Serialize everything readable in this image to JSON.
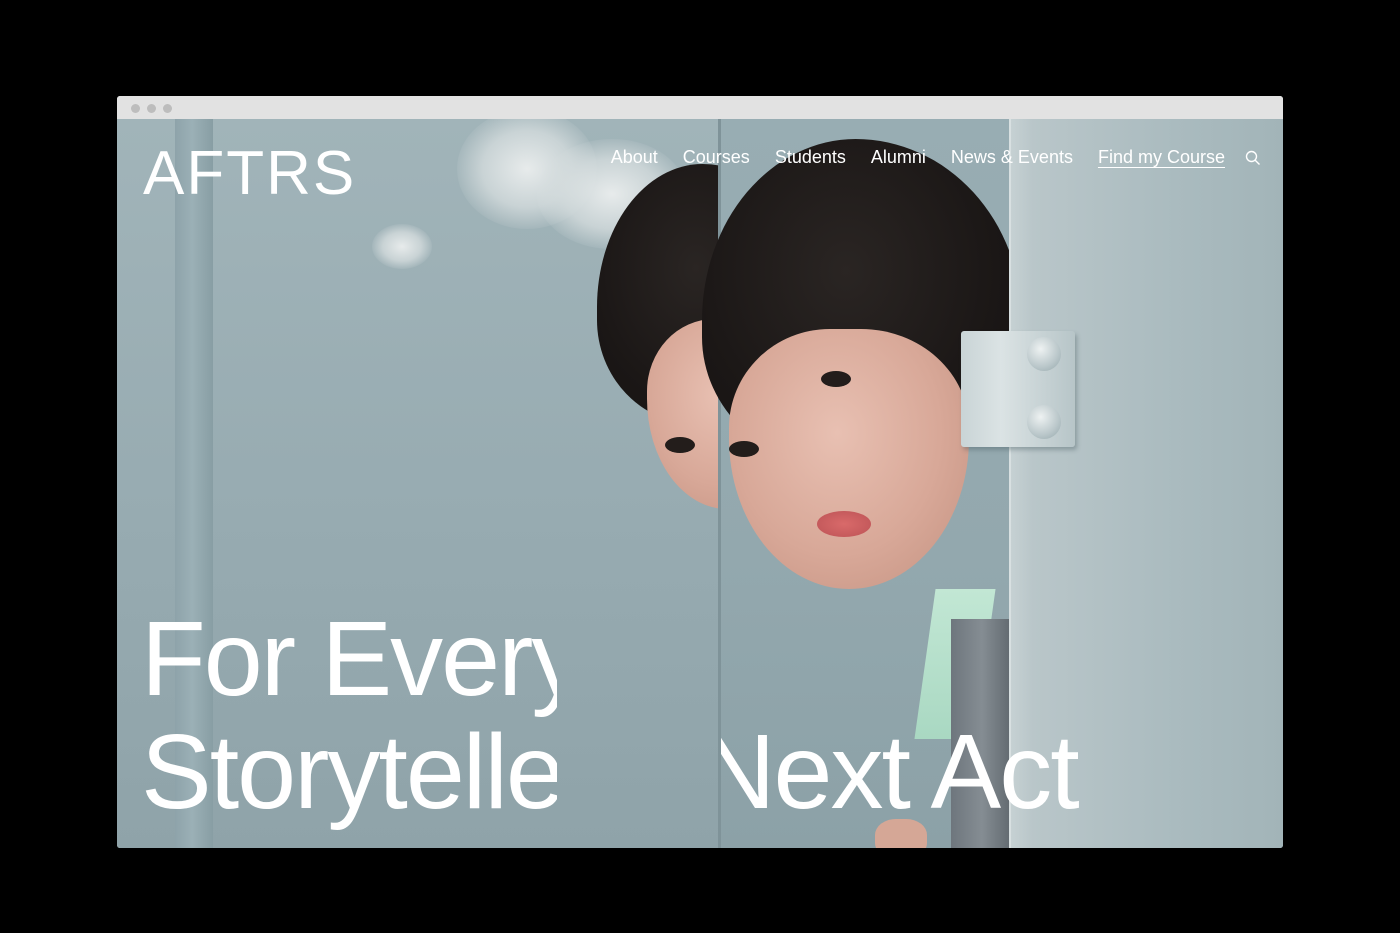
{
  "browser": {
    "window_dots": 3
  },
  "header": {
    "logo": "AFTRS",
    "nav": [
      {
        "label": "About"
      },
      {
        "label": "Courses"
      },
      {
        "label": "Students"
      },
      {
        "label": "Alumni"
      },
      {
        "label": "News & Events"
      },
      {
        "label": "Find my Course"
      }
    ],
    "search_icon": "search-icon"
  },
  "hero": {
    "headline_left_line1": "For Every",
    "headline_left_line2": "Storyteller",
    "headline_right_line2": "Next Act"
  },
  "colors": {
    "background": "#000000",
    "text": "#ffffff",
    "wall": "#9fb2b7"
  }
}
